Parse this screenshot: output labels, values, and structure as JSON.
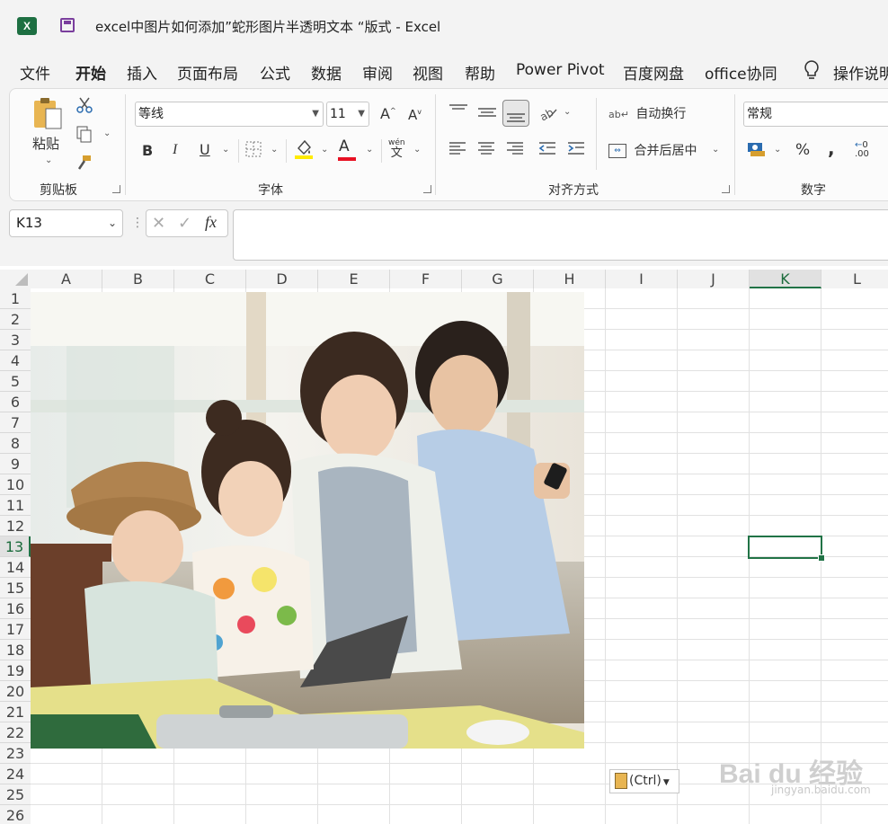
{
  "window": {
    "app_icon": "excel-logo-icon",
    "title": "excel中图片如何添加”蛇形图片半透明文本 “版式  -  Excel"
  },
  "menu": {
    "items": [
      "文件",
      "开始",
      "插入",
      "页面布局",
      "公式",
      "数据",
      "审阅",
      "视图",
      "帮助",
      "Power Pivot",
      "百度网盘",
      "office协同"
    ],
    "active": "开始",
    "tell_me": "操作说明"
  },
  "ribbon": {
    "clipboard": {
      "paste_label": "粘贴",
      "group_label": "剪贴板"
    },
    "font": {
      "font_name": "等线",
      "font_size": "11",
      "bold": "B",
      "italic": "I",
      "underline": "U",
      "grow": "A",
      "shrink": "A",
      "font_color_letter": "A",
      "phonetic_top": "wén",
      "phonetic_bottom": "文",
      "group_label": "字体",
      "highlight_color": "#ffeb00",
      "font_color": "#e81123"
    },
    "alignment": {
      "wrap_text": "自动换行",
      "merge_center": "合并后居中",
      "group_label": "对齐方式"
    },
    "number": {
      "format": "常规",
      "percent": "%",
      "comma": ",",
      "group_label": "数字"
    }
  },
  "formula_bar": {
    "name_box": "K13",
    "fx": "fx",
    "value": ""
  },
  "sheet": {
    "columns": [
      "A",
      "B",
      "C",
      "D",
      "E",
      "F",
      "G",
      "H",
      "I",
      "J",
      "K",
      "L"
    ],
    "rows": [
      "1",
      "2",
      "3",
      "4",
      "5",
      "6",
      "7",
      "8",
      "9",
      "10",
      "11",
      "12",
      "13",
      "14",
      "15",
      "16",
      "17",
      "18",
      "19",
      "20",
      "21",
      "22",
      "23",
      "24",
      "25",
      "26"
    ],
    "selected_cell": "K13",
    "selected_column": "K",
    "selected_row": "13",
    "accent_color": "#217346"
  },
  "picture": {
    "description_icon": "family-photo-image"
  },
  "paste_options": {
    "label": "(Ctrl)"
  },
  "watermark": {
    "brand": "Bai du 经验",
    "url": "jingyan.baidu.com"
  }
}
